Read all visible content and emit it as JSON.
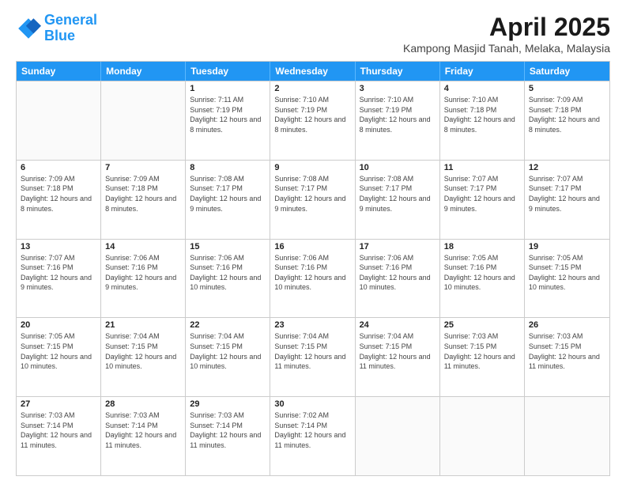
{
  "header": {
    "logo_line1": "General",
    "logo_line2": "Blue",
    "month": "April 2025",
    "location": "Kampong Masjid Tanah, Melaka, Malaysia"
  },
  "days_of_week": [
    "Sunday",
    "Monday",
    "Tuesday",
    "Wednesday",
    "Thursday",
    "Friday",
    "Saturday"
  ],
  "weeks": [
    [
      {
        "day": "",
        "sunrise": "",
        "sunset": "",
        "daylight": ""
      },
      {
        "day": "",
        "sunrise": "",
        "sunset": "",
        "daylight": ""
      },
      {
        "day": "1",
        "sunrise": "Sunrise: 7:11 AM",
        "sunset": "Sunset: 7:19 PM",
        "daylight": "Daylight: 12 hours and 8 minutes."
      },
      {
        "day": "2",
        "sunrise": "Sunrise: 7:10 AM",
        "sunset": "Sunset: 7:19 PM",
        "daylight": "Daylight: 12 hours and 8 minutes."
      },
      {
        "day": "3",
        "sunrise": "Sunrise: 7:10 AM",
        "sunset": "Sunset: 7:19 PM",
        "daylight": "Daylight: 12 hours and 8 minutes."
      },
      {
        "day": "4",
        "sunrise": "Sunrise: 7:10 AM",
        "sunset": "Sunset: 7:18 PM",
        "daylight": "Daylight: 12 hours and 8 minutes."
      },
      {
        "day": "5",
        "sunrise": "Sunrise: 7:09 AM",
        "sunset": "Sunset: 7:18 PM",
        "daylight": "Daylight: 12 hours and 8 minutes."
      }
    ],
    [
      {
        "day": "6",
        "sunrise": "Sunrise: 7:09 AM",
        "sunset": "Sunset: 7:18 PM",
        "daylight": "Daylight: 12 hours and 8 minutes."
      },
      {
        "day": "7",
        "sunrise": "Sunrise: 7:09 AM",
        "sunset": "Sunset: 7:18 PM",
        "daylight": "Daylight: 12 hours and 8 minutes."
      },
      {
        "day": "8",
        "sunrise": "Sunrise: 7:08 AM",
        "sunset": "Sunset: 7:17 PM",
        "daylight": "Daylight: 12 hours and 9 minutes."
      },
      {
        "day": "9",
        "sunrise": "Sunrise: 7:08 AM",
        "sunset": "Sunset: 7:17 PM",
        "daylight": "Daylight: 12 hours and 9 minutes."
      },
      {
        "day": "10",
        "sunrise": "Sunrise: 7:08 AM",
        "sunset": "Sunset: 7:17 PM",
        "daylight": "Daylight: 12 hours and 9 minutes."
      },
      {
        "day": "11",
        "sunrise": "Sunrise: 7:07 AM",
        "sunset": "Sunset: 7:17 PM",
        "daylight": "Daylight: 12 hours and 9 minutes."
      },
      {
        "day": "12",
        "sunrise": "Sunrise: 7:07 AM",
        "sunset": "Sunset: 7:17 PM",
        "daylight": "Daylight: 12 hours and 9 minutes."
      }
    ],
    [
      {
        "day": "13",
        "sunrise": "Sunrise: 7:07 AM",
        "sunset": "Sunset: 7:16 PM",
        "daylight": "Daylight: 12 hours and 9 minutes."
      },
      {
        "day": "14",
        "sunrise": "Sunrise: 7:06 AM",
        "sunset": "Sunset: 7:16 PM",
        "daylight": "Daylight: 12 hours and 9 minutes."
      },
      {
        "day": "15",
        "sunrise": "Sunrise: 7:06 AM",
        "sunset": "Sunset: 7:16 PM",
        "daylight": "Daylight: 12 hours and 10 minutes."
      },
      {
        "day": "16",
        "sunrise": "Sunrise: 7:06 AM",
        "sunset": "Sunset: 7:16 PM",
        "daylight": "Daylight: 12 hours and 10 minutes."
      },
      {
        "day": "17",
        "sunrise": "Sunrise: 7:06 AM",
        "sunset": "Sunset: 7:16 PM",
        "daylight": "Daylight: 12 hours and 10 minutes."
      },
      {
        "day": "18",
        "sunrise": "Sunrise: 7:05 AM",
        "sunset": "Sunset: 7:16 PM",
        "daylight": "Daylight: 12 hours and 10 minutes."
      },
      {
        "day": "19",
        "sunrise": "Sunrise: 7:05 AM",
        "sunset": "Sunset: 7:15 PM",
        "daylight": "Daylight: 12 hours and 10 minutes."
      }
    ],
    [
      {
        "day": "20",
        "sunrise": "Sunrise: 7:05 AM",
        "sunset": "Sunset: 7:15 PM",
        "daylight": "Daylight: 12 hours and 10 minutes."
      },
      {
        "day": "21",
        "sunrise": "Sunrise: 7:04 AM",
        "sunset": "Sunset: 7:15 PM",
        "daylight": "Daylight: 12 hours and 10 minutes."
      },
      {
        "day": "22",
        "sunrise": "Sunrise: 7:04 AM",
        "sunset": "Sunset: 7:15 PM",
        "daylight": "Daylight: 12 hours and 10 minutes."
      },
      {
        "day": "23",
        "sunrise": "Sunrise: 7:04 AM",
        "sunset": "Sunset: 7:15 PM",
        "daylight": "Daylight: 12 hours and 11 minutes."
      },
      {
        "day": "24",
        "sunrise": "Sunrise: 7:04 AM",
        "sunset": "Sunset: 7:15 PM",
        "daylight": "Daylight: 12 hours and 11 minutes."
      },
      {
        "day": "25",
        "sunrise": "Sunrise: 7:03 AM",
        "sunset": "Sunset: 7:15 PM",
        "daylight": "Daylight: 12 hours and 11 minutes."
      },
      {
        "day": "26",
        "sunrise": "Sunrise: 7:03 AM",
        "sunset": "Sunset: 7:15 PM",
        "daylight": "Daylight: 12 hours and 11 minutes."
      }
    ],
    [
      {
        "day": "27",
        "sunrise": "Sunrise: 7:03 AM",
        "sunset": "Sunset: 7:14 PM",
        "daylight": "Daylight: 12 hours and 11 minutes."
      },
      {
        "day": "28",
        "sunrise": "Sunrise: 7:03 AM",
        "sunset": "Sunset: 7:14 PM",
        "daylight": "Daylight: 12 hours and 11 minutes."
      },
      {
        "day": "29",
        "sunrise": "Sunrise: 7:03 AM",
        "sunset": "Sunset: 7:14 PM",
        "daylight": "Daylight: 12 hours and 11 minutes."
      },
      {
        "day": "30",
        "sunrise": "Sunrise: 7:02 AM",
        "sunset": "Sunset: 7:14 PM",
        "daylight": "Daylight: 12 hours and 11 minutes."
      },
      {
        "day": "",
        "sunrise": "",
        "sunset": "",
        "daylight": ""
      },
      {
        "day": "",
        "sunrise": "",
        "sunset": "",
        "daylight": ""
      },
      {
        "day": "",
        "sunrise": "",
        "sunset": "",
        "daylight": ""
      }
    ]
  ]
}
